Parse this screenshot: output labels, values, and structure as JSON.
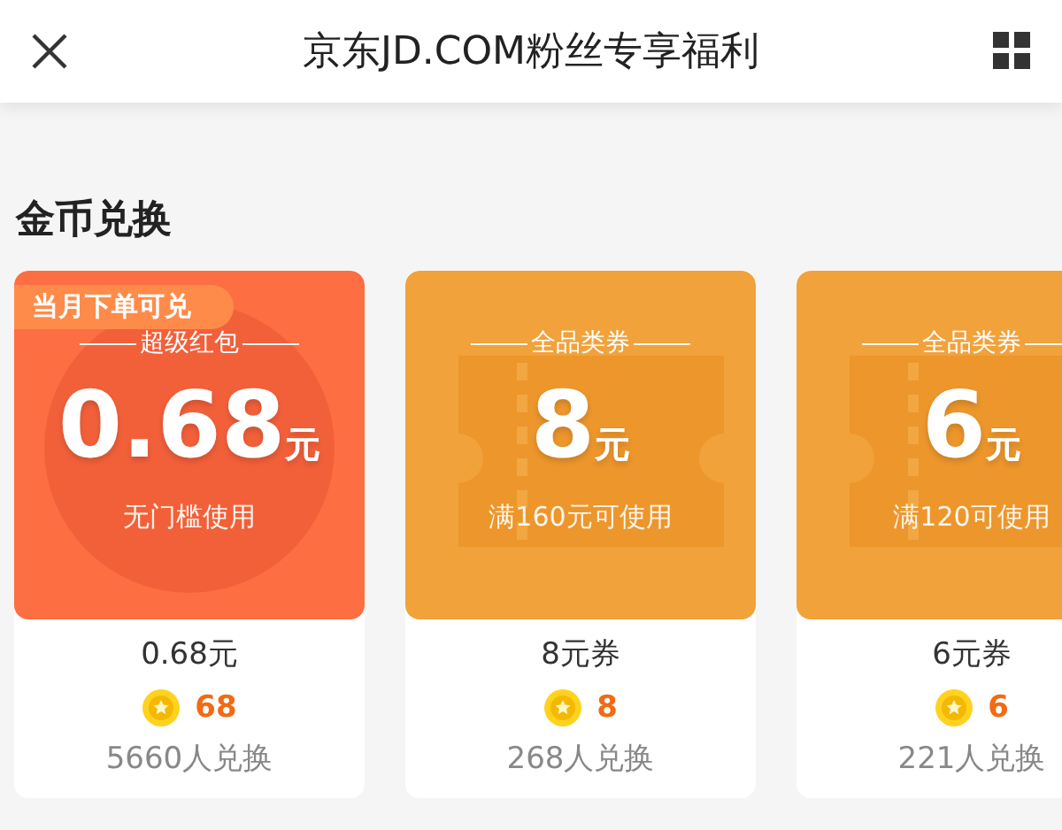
{
  "header": {
    "title": "京东JD.COM粉丝专享福利"
  },
  "section": {
    "title": "金币兑换"
  },
  "cards": [
    {
      "kind": "red_packet",
      "badge": "当月下单可兑",
      "category": "超级红包",
      "amount": "0.68",
      "unit": "元",
      "condition": "无门槛使用",
      "name": "0.68元",
      "coins": "68",
      "redeemed": "5660人兑换"
    },
    {
      "kind": "coupon",
      "category": "全品类券",
      "amount": "8",
      "unit": "元",
      "condition": "满160元可使用",
      "name": "8元券",
      "coins": "8",
      "redeemed": "268人兑换"
    },
    {
      "kind": "coupon",
      "category": "全品类券",
      "amount": "6",
      "unit": "元",
      "condition": "满120可使用",
      "name": "6元券",
      "coins": "6",
      "redeemed": "221人兑换"
    }
  ]
}
